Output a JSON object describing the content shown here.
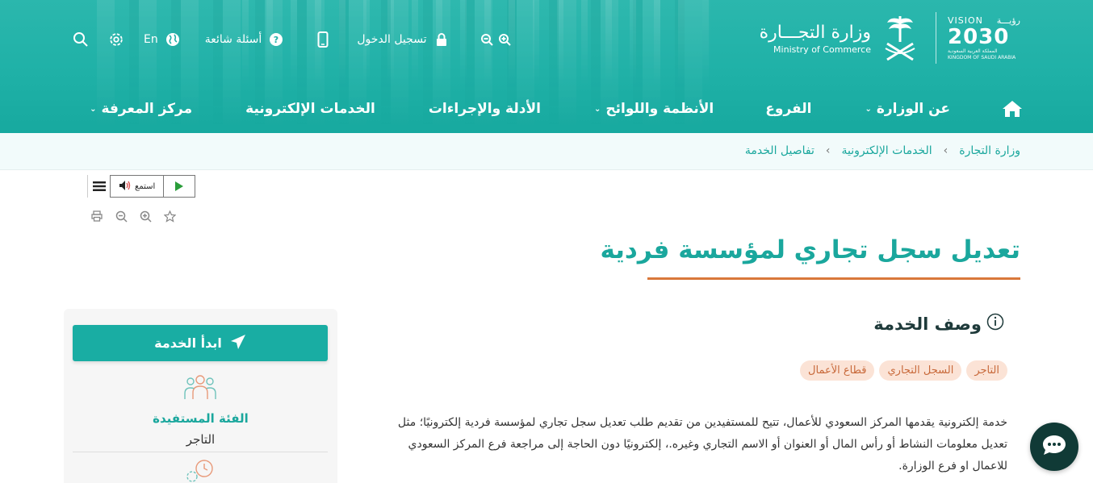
{
  "header": {
    "vision": {
      "line1_en": "VISION",
      "line1_ar": "رؤيـــة",
      "year": "2030",
      "country_ar": "المملكة العربية السعودية",
      "country_en": "KINGDOM OF SAUDI ARABIA"
    },
    "ministry": {
      "name_ar": "وزارة التجـــارة",
      "name_en": "Ministry of Commerce"
    },
    "topbar": {
      "zoom_icons": "zoom-in-out",
      "login_label": "تسجيل الدخول",
      "faq_label": "أسئلة شائعة",
      "lang_label": "En"
    },
    "nav": [
      {
        "label": "عن الوزارة",
        "dropdown": true
      },
      {
        "label": "الفروع",
        "dropdown": false
      },
      {
        "label": "الأنظمة واللوائح",
        "dropdown": true
      },
      {
        "label": "الأدلة والإجراءات",
        "dropdown": false
      },
      {
        "label": "الخدمات الإلكترونية",
        "dropdown": false
      },
      {
        "label": "مركز المعرفة",
        "dropdown": true
      }
    ]
  },
  "breadcrumb": [
    "وزارة التجارة",
    "الخدمات الإلكترونية",
    "تفاصيل الخدمة"
  ],
  "listen": {
    "label": "استمع"
  },
  "page": {
    "title": "تعديل سجل تجاري لمؤسسة فردية"
  },
  "service": {
    "section_title": "وصف الخدمة",
    "tags": [
      "التاجر",
      "السجل التجاري",
      "قطاع الأعمال"
    ],
    "description": "خدمة إلكترونية يقدمها المركز السعودي للأعمال، تتيح للمستفيدين من تقديم طلب تعديل سجل تجاري لمؤسسة فردية إلكترونيًا؛ مثل تعديل معلومات النشاط أو رأس المال أو العنوان أو الاسم التجاري وغيره.، إلكترونيًا دون الحاجة إلى مراجعة فرع المركز السعودي للاعمال او فرع الوزارة."
  },
  "sidebar": {
    "start_button": "ابدأ الخدمة",
    "beneficiary_title": "الفئة المستفيدة",
    "beneficiary_value": "التاجر"
  },
  "colors": {
    "primary": "#1aa79d",
    "accent": "#d9783a",
    "chat": "#103a36"
  }
}
